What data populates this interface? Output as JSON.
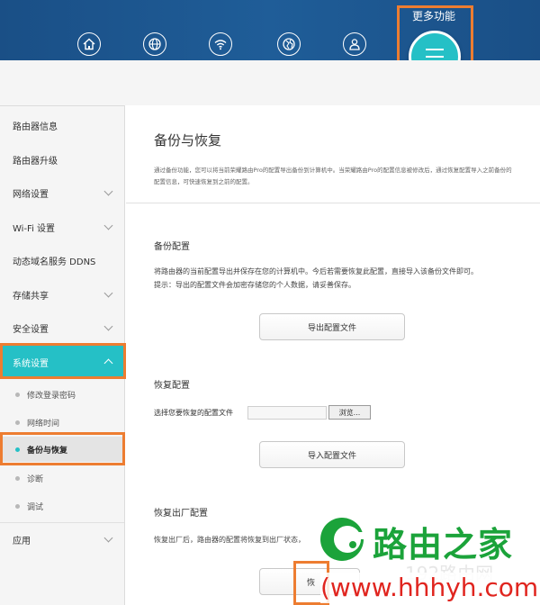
{
  "header": {
    "more_label": "更多功能",
    "nav_icons": [
      "home-icon",
      "globe-icon",
      "wifi-icon",
      "network-globe-icon",
      "user-icon"
    ],
    "menu_icon": "hamburger-menu-icon",
    "colors": {
      "bar": "#1f5d98",
      "accent": "#25c0c6",
      "highlight": "#ed7d31"
    }
  },
  "sidebar": {
    "items": [
      {
        "label": "路由器信息",
        "has_chevron": false
      },
      {
        "label": "路由器升级",
        "has_chevron": false
      },
      {
        "label": "网络设置",
        "has_chevron": true
      },
      {
        "label": "Wi-Fi 设置",
        "has_chevron": true
      },
      {
        "label": "动态域名服务 DDNS",
        "has_chevron": false
      },
      {
        "label": "存储共享",
        "has_chevron": true
      },
      {
        "label": "安全设置",
        "has_chevron": true
      },
      {
        "label": "系统设置",
        "has_chevron": true,
        "active": true
      }
    ],
    "sub_items": [
      {
        "label": "修改登录密码"
      },
      {
        "label": "网络时间"
      },
      {
        "label": "备份与恢复",
        "current": true
      },
      {
        "label": "诊断"
      },
      {
        "label": "调试"
      }
    ],
    "after_items": [
      {
        "label": "应用",
        "has_chevron": true
      }
    ]
  },
  "main": {
    "title": "备份与恢复",
    "description": "通过备份功能，您可以将当前荣耀路由Pro的配置导出备份到计算机中。当荣耀路由Pro的配置信息被修改后，通过恢复配置导入之前备份的配置信息，可快速恢复到之前的配置。",
    "backup": {
      "title": "备份配置",
      "text_line1": "将路由器的当前配置导出并保存在您的计算机中。今后若需要恢复此配置，直接导入该备份文件即可。",
      "text_line2": "提示：导出的配置文件会加密存储您的个人数据，请妥善保存。",
      "button": "导出配置文件"
    },
    "restore": {
      "title": "恢复配置",
      "file_label": "选择您要恢复的配置文件",
      "browse": "浏览...",
      "button": "导入配置文件"
    },
    "factory": {
      "title": "恢复出厂配置",
      "text": "恢复出厂后，路由器的配置将恢复到出厂状态，",
      "button": "恢"
    }
  },
  "watermark": {
    "title": "路由之家",
    "ghost": "192路由网",
    "url": "(www.hhhyh.com)"
  }
}
